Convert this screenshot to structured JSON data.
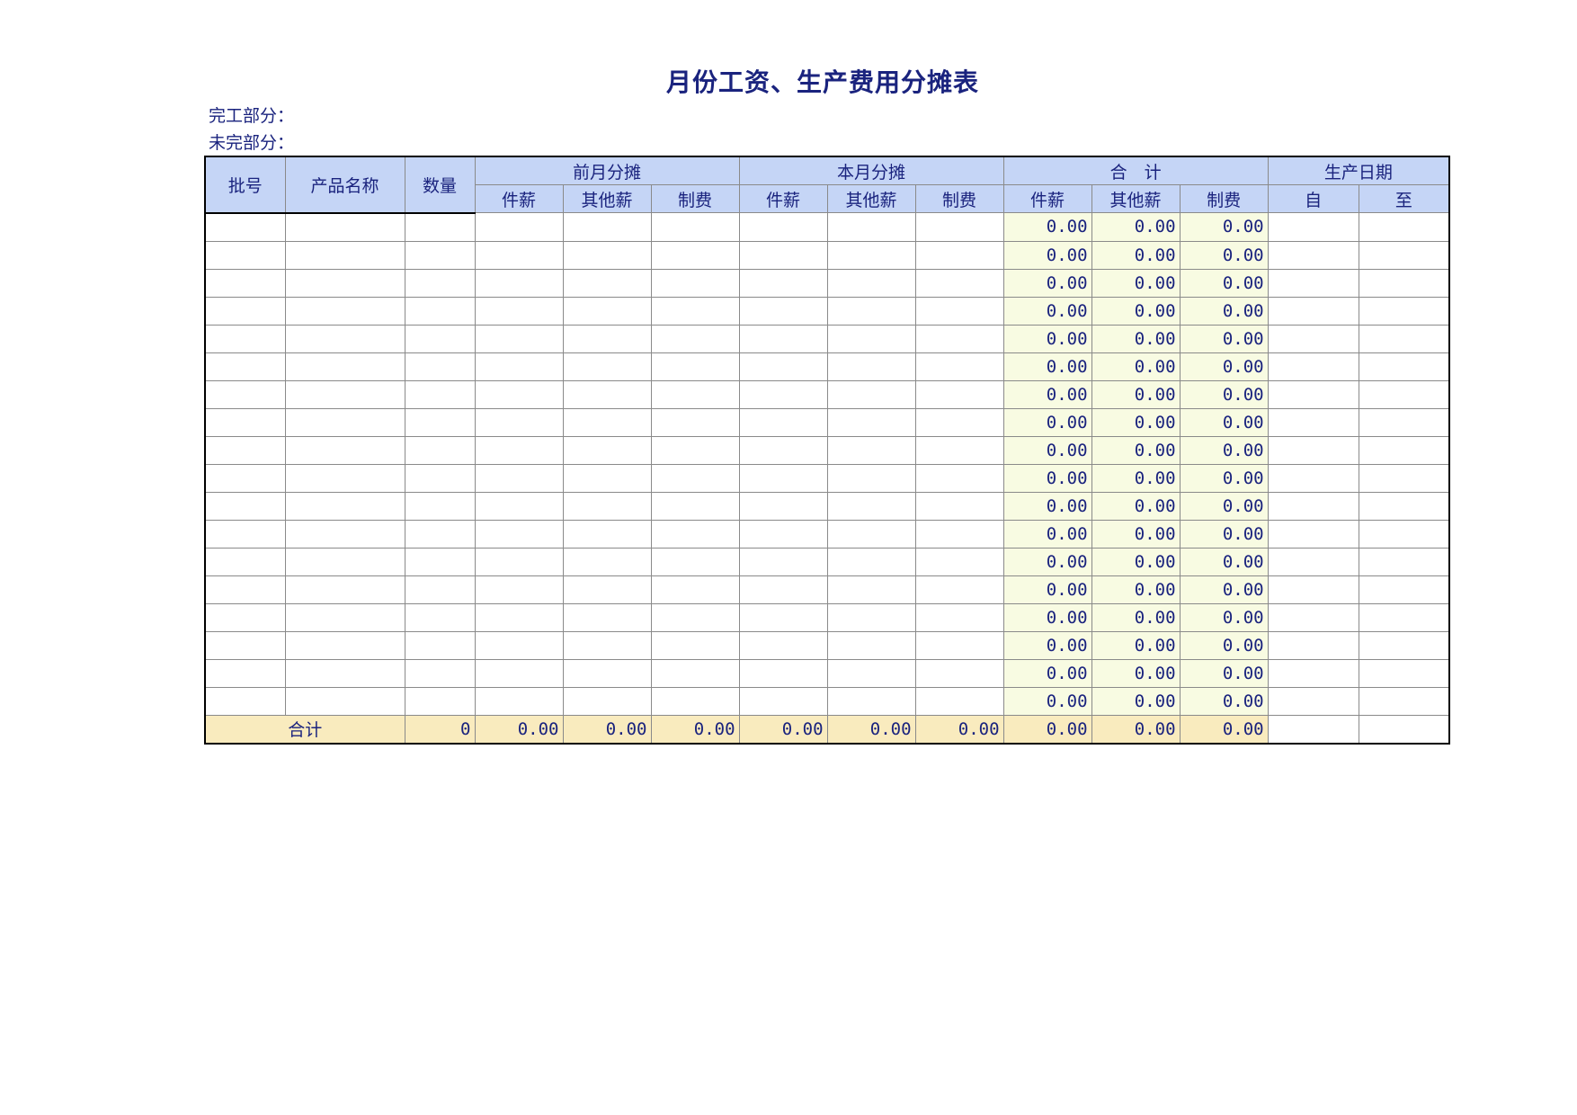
{
  "title": "月份工资、生产费用分摊表",
  "labels": {
    "completed": "完工部分：",
    "uncompleted": "未完部分："
  },
  "header": {
    "batch_no": "批号",
    "product_name": "产品名称",
    "quantity": "数量",
    "prev_month": "前月分摊",
    "this_month": "本月分摊",
    "total": "合　计",
    "prod_date": "生产日期",
    "piece_wage": "件薪",
    "other_wage": "其他薪",
    "overhead": "制费",
    "from": "自",
    "to": "至"
  },
  "rows_total_values": [
    [
      "0.00",
      "0.00",
      "0.00"
    ],
    [
      "0.00",
      "0.00",
      "0.00"
    ],
    [
      "0.00",
      "0.00",
      "0.00"
    ],
    [
      "0.00",
      "0.00",
      "0.00"
    ],
    [
      "0.00",
      "0.00",
      "0.00"
    ],
    [
      "0.00",
      "0.00",
      "0.00"
    ],
    [
      "0.00",
      "0.00",
      "0.00"
    ],
    [
      "0.00",
      "0.00",
      "0.00"
    ],
    [
      "0.00",
      "0.00",
      "0.00"
    ],
    [
      "0.00",
      "0.00",
      "0.00"
    ],
    [
      "0.00",
      "0.00",
      "0.00"
    ],
    [
      "0.00",
      "0.00",
      "0.00"
    ],
    [
      "0.00",
      "0.00",
      "0.00"
    ],
    [
      "0.00",
      "0.00",
      "0.00"
    ],
    [
      "0.00",
      "0.00",
      "0.00"
    ],
    [
      "0.00",
      "0.00",
      "0.00"
    ],
    [
      "0.00",
      "0.00",
      "0.00"
    ],
    [
      "0.00",
      "0.00",
      "0.00"
    ]
  ],
  "total_row": {
    "label": "合计",
    "quantity": "0",
    "prev_piece": "0.00",
    "prev_other": "0.00",
    "prev_overhead": "0.00",
    "this_piece": "0.00",
    "this_other": "0.00",
    "this_overhead": "0.00",
    "sum_piece": "0.00",
    "sum_other": "0.00",
    "sum_overhead": "0.00"
  },
  "colors": {
    "header_bg": "#c5d5f6",
    "sum_col_bg": "#f8fbe2",
    "total_row_bg": "#f9ebbe",
    "text": "#1a237e"
  }
}
